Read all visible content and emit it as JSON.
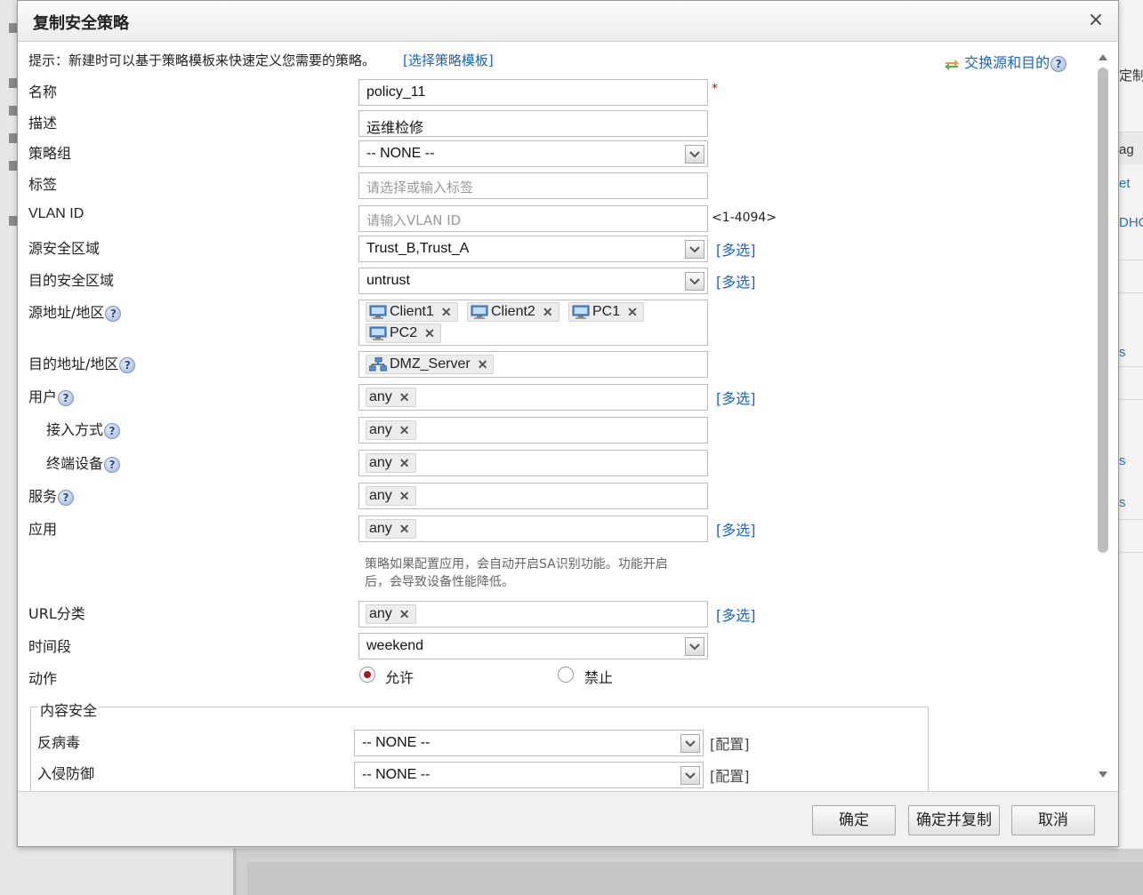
{
  "background": {
    "right_texts": [
      "定制",
      "ag",
      "et",
      "DHC",
      "s",
      "s",
      "s"
    ]
  },
  "dialog": {
    "title": "复制安全策略",
    "close_symbol": "×",
    "hint": "提示：新建时可以基于策略模板来快速定义您需要的策略。",
    "template_link": "[选择策略模板]",
    "swap_link": "交换源和目的",
    "help_symbol": "?",
    "required_mark": "*",
    "multi_select": "[多选]",
    "fields": {
      "name": {
        "label": "名称",
        "value": "policy_11"
      },
      "description": {
        "label": "描述",
        "value": "运维检修"
      },
      "policy_group": {
        "label": "策略组",
        "value": "-- NONE --"
      },
      "tag": {
        "label": "标签",
        "placeholder": "请选择或输入标签"
      },
      "vlan_id": {
        "label": "VLAN ID",
        "placeholder": "请输入VLAN ID",
        "range": "<1-4094>"
      },
      "src_zone": {
        "label": "源安全区域",
        "value": "Trust_B,Trust_A"
      },
      "dst_zone": {
        "label": "目的安全区域",
        "value": "untrust"
      },
      "src_addr": {
        "label": "源地址/地区",
        "tags": [
          "Client1",
          "Client2",
          "PC1",
          "PC2"
        ]
      },
      "dst_addr": {
        "label": "目的地址/地区",
        "tags": [
          "DMZ_Server"
        ]
      },
      "user": {
        "label": "用户",
        "tag": "any"
      },
      "access_method": {
        "label": "接入方式",
        "tag": "any"
      },
      "terminal_device": {
        "label": "终端设备",
        "tag": "any"
      },
      "service": {
        "label": "服务",
        "tag": "any"
      },
      "application": {
        "label": "应用",
        "tag": "any",
        "note_line1": "策略如果配置应用，会自动开启SA识别功能。功能开启",
        "note_line2": "后，会导致设备性能降低。"
      },
      "url_category": {
        "label": "URL分类",
        "tag": "any"
      },
      "time_range": {
        "label": "时间段",
        "value": "weekend"
      },
      "action": {
        "label": "动作",
        "options": [
          "允许",
          "禁止"
        ],
        "selected": "允许"
      }
    },
    "content_security": {
      "legend": "内容安全",
      "antivirus": {
        "label": "反病毒",
        "value": "-- NONE --",
        "config": "[配置]"
      },
      "ips": {
        "label": "入侵防御",
        "value": "-- NONE --",
        "config": "[配置]"
      }
    },
    "buttons": {
      "ok": "确定",
      "ok_copy": "确定并复制",
      "cancel": "取消"
    },
    "colors": {
      "link": "#1a64c8",
      "required": "#cc0000",
      "radio_selected": "#a11a1a"
    }
  }
}
